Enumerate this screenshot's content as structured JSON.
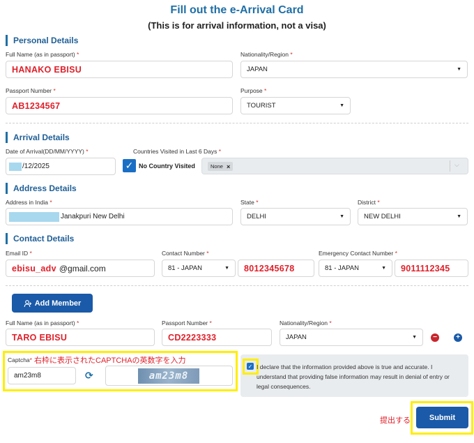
{
  "header": {
    "title": "Fill out the e-Arrival Card",
    "subtitle": "(This is for arrival information, not a visa)"
  },
  "personal": {
    "section_title": "Personal Details",
    "full_name_label": "Full Name (as in passport)",
    "full_name_value": "HANAKO EBISU",
    "nationality_label": "Nationality/Region",
    "nationality_value": "JAPAN",
    "passport_label": "Passport Number",
    "passport_value": "AB1234567",
    "purpose_label": "Purpose",
    "purpose_value": "TOURIST"
  },
  "arrival": {
    "section_title": "Arrival Details",
    "date_label": "Date of Arrival(DD/MM/YYYY)",
    "date_value": "/12/2025",
    "countries_label": "Countries Visited in Last 6 Days",
    "no_country_label": "No Country Visited",
    "tag_value": "None",
    "tag_remove": "×"
  },
  "address": {
    "section_title": "Address Details",
    "address_label": "Address in India",
    "address_value": "Janakpuri New Delhi",
    "state_label": "State",
    "state_value": "DELHI",
    "district_label": "District",
    "district_value": "NEW DELHI"
  },
  "contact": {
    "section_title": "Contact Details",
    "email_label": "Email ID",
    "email_user": "ebisu_adv",
    "email_domain": "@gmail.com",
    "contact_label": "Contact Number",
    "contact_code": "81 - JAPAN",
    "contact_number": "8012345678",
    "emergency_label": "Emergency Contact Number",
    "emergency_code": "81 - JAPAN",
    "emergency_number": "9011112345"
  },
  "member": {
    "add_button": "Add Member",
    "full_name_label": "Full Name (as in passport)",
    "full_name_value": "TARO EBISU",
    "passport_label": "Passport Number",
    "passport_value": "CD2223333",
    "nationality_label": "Nationality/Region",
    "nationality_value": "JAPAN",
    "remove_symbol": "−",
    "add_symbol": "+"
  },
  "captcha": {
    "label": "Captcha",
    "annotation": "右枠に表示されたCAPTCHAの英数字を入力",
    "input_value": "am23m8",
    "image_text": "am23m8"
  },
  "declaration": {
    "text": "I declare that the information provided above is true and accurate. I understand that providing false information may result in denial of entry or legal consequences."
  },
  "footer": {
    "submit_annotation": "提出する",
    "submit_label": "Submit"
  },
  "colors": {
    "accent": "#1a5aa8",
    "heading": "#1f6fa6",
    "highlight": "#ffee00",
    "red_value": "#e0202a"
  }
}
